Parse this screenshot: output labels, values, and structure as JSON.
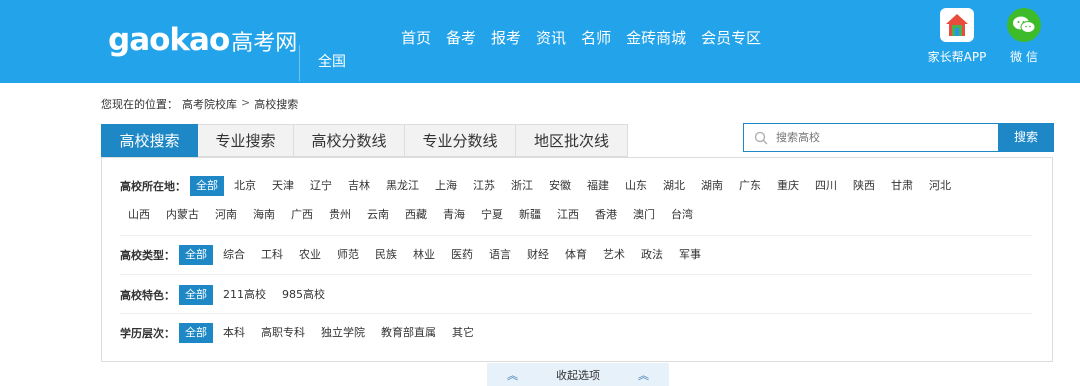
{
  "header": {
    "logo_en": "gaokao",
    "logo_cn": "高考网",
    "region": "全国",
    "nav": [
      "首页",
      "备考",
      "报考",
      "资讯",
      "名师",
      "金砖商城",
      "会员专区"
    ],
    "parent_app_label": "家长帮APP",
    "wechat_label": "微 信"
  },
  "breadcrumb": {
    "prefix": "您现在的位置：",
    "items": [
      "高考院校库",
      "高校搜索"
    ],
    "separator": ">"
  },
  "tabs": [
    "高校搜索",
    "专业搜索",
    "高校分数线",
    "专业分数线",
    "地区批次线"
  ],
  "search": {
    "placeholder": "搜索高校",
    "button": "搜索"
  },
  "filters": {
    "location": {
      "label": "高校所在地：",
      "options_row1": [
        "全部",
        "北京",
        "天津",
        "辽宁",
        "吉林",
        "黑龙江",
        "上海",
        "江苏",
        "浙江",
        "安徽",
        "福建",
        "山东",
        "湖北",
        "湖南",
        "广东",
        "重庆",
        "四川",
        "陕西",
        "甘肃",
        "河北"
      ],
      "options_row2": [
        "山西",
        "内蒙古",
        "河南",
        "海南",
        "广西",
        "贵州",
        "云南",
        "西藏",
        "青海",
        "宁夏",
        "新疆",
        "江西",
        "香港",
        "澳门",
        "台湾"
      ]
    },
    "type": {
      "label": "高校类型：",
      "options": [
        "全部",
        "综合",
        "工科",
        "农业",
        "师范",
        "民族",
        "林业",
        "医药",
        "语言",
        "财经",
        "体育",
        "艺术",
        "政法",
        "军事"
      ]
    },
    "feature": {
      "label": "高校特色：",
      "options": [
        "全部",
        "211高校",
        "985高校"
      ]
    },
    "level": {
      "label": "学历层次：",
      "options": [
        "全部",
        "本科",
        "高职专科",
        "独立学院",
        "教育部直属",
        "其它"
      ]
    }
  },
  "collapse_label": "收起选项",
  "colors": {
    "header_bg": "#22a3ea",
    "accent": "#1e88c7",
    "collapse_bg": "#e7f1fa"
  }
}
